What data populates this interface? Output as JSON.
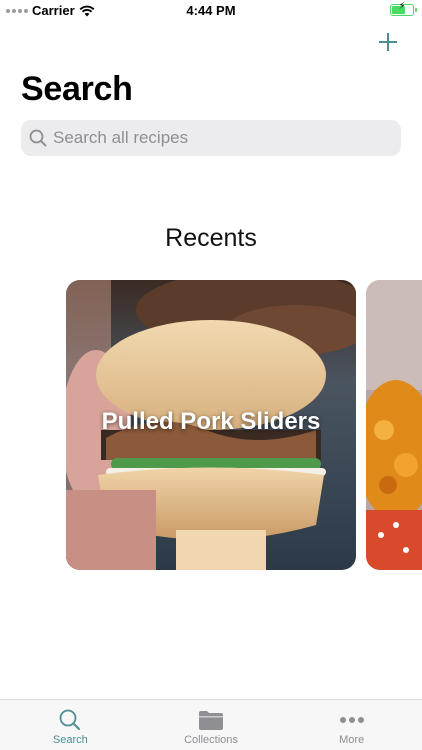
{
  "status_bar": {
    "carrier": "Carrier",
    "time": "4:44 PM",
    "battery_level": 0.7
  },
  "header": {
    "add_icon": "plus-icon",
    "title": "Search"
  },
  "search": {
    "placeholder": "Search all recipes",
    "value": "",
    "icon": "search-icon"
  },
  "recents": {
    "heading": "Recents",
    "cards": [
      {
        "label": "Pulled Pork Sliders"
      },
      {
        "label": ""
      }
    ]
  },
  "tab_bar": {
    "tabs": [
      {
        "label": "Search",
        "icon": "search-icon",
        "active": true
      },
      {
        "label": "Collections",
        "icon": "folder-icon",
        "active": false
      },
      {
        "label": "More",
        "icon": "more-dots-icon",
        "active": false
      }
    ]
  },
  "colors": {
    "accent": "#4b8f95",
    "battery": "#4cd964",
    "inactive_tab": "#8e8e93"
  }
}
